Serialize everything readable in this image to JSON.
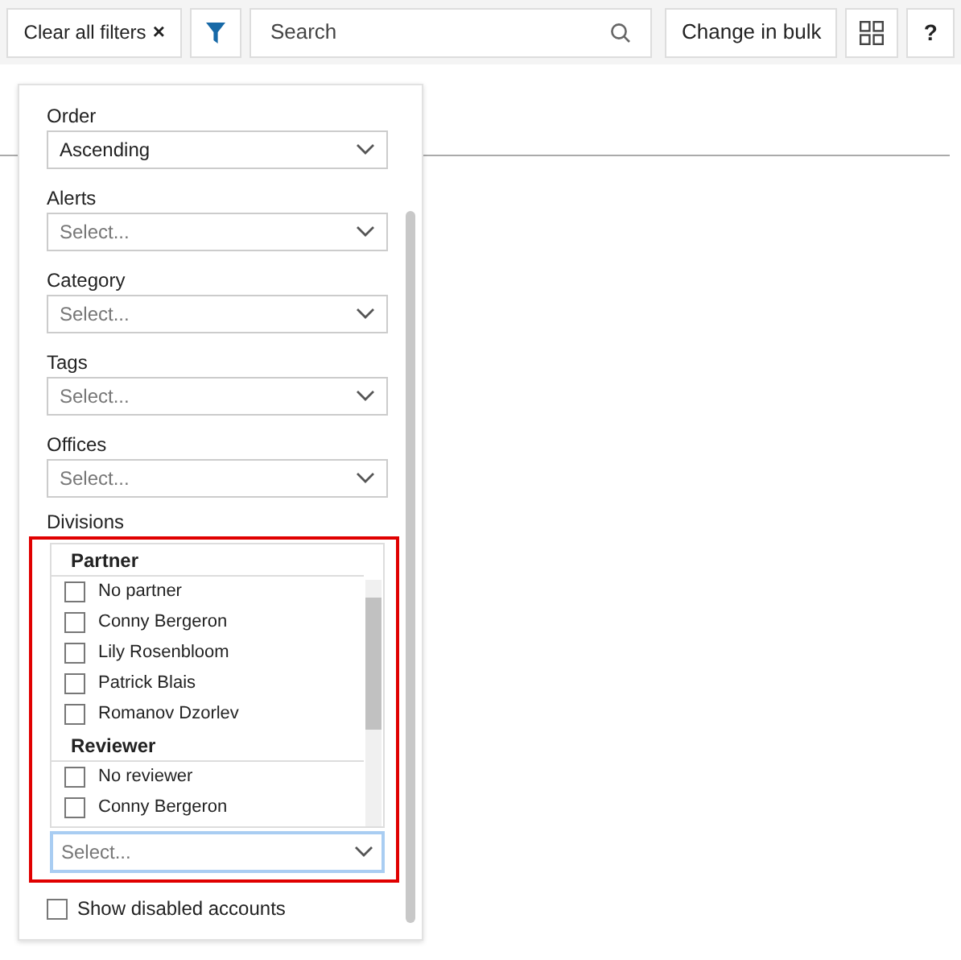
{
  "toolbar": {
    "clear_button": {
      "label": "Clear all filters",
      "icon": "×"
    },
    "filter_active": true,
    "search": {
      "placeholder": "Search"
    },
    "bulk_button": "Change in bulk",
    "help_button": "?"
  },
  "filter_panel": {
    "fields": [
      {
        "label": "Order",
        "value": "Ascending"
      },
      {
        "label": "Alerts",
        "placeholder": "Select..."
      },
      {
        "label": "Category",
        "placeholder": "Select..."
      },
      {
        "label": "Tags",
        "placeholder": "Select..."
      },
      {
        "label": "Offices",
        "placeholder": "Select..."
      }
    ],
    "divisions": {
      "label": "Divisions",
      "highlighted": true,
      "groups": [
        {
          "title": "Partner",
          "options": [
            {
              "label": "No partner",
              "checked": false
            },
            {
              "label": "Conny Bergeron",
              "checked": false
            },
            {
              "label": "Lily Rosenbloom",
              "checked": false
            },
            {
              "label": "Patrick Blais",
              "checked": false
            },
            {
              "label": "Romanov Dzorlev",
              "checked": false
            }
          ]
        },
        {
          "title": "Reviewer",
          "options": [
            {
              "label": "No reviewer",
              "checked": false
            },
            {
              "label": "Conny Bergeron",
              "checked": false
            }
          ]
        }
      ],
      "input": {
        "placeholder": "Select...",
        "focused": true
      }
    },
    "show_disabled": {
      "label": "Show disabled accounts",
      "checked": false
    }
  }
}
